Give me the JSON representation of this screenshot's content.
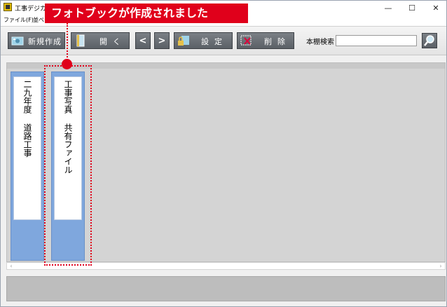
{
  "window": {
    "title": "工事デジカメ",
    "controls": {
      "minimize": "—",
      "maximize": "☐",
      "close": "✕"
    }
  },
  "menu": {
    "items": [
      "ファイル(F)",
      "並べ"
    ]
  },
  "callout": {
    "text": "フォトブックが作成されました"
  },
  "toolbar": {
    "new_label": "新規作成",
    "open_label": "開く",
    "prev_label": "<",
    "next_label": ">",
    "settings_label": "設定",
    "delete_label": "削除",
    "search_label": "本棚検索",
    "search_value": ""
  },
  "shelf": {
    "books": [
      {
        "title": "二九年度 道路工事"
      },
      {
        "title": "工事写真 共有ファイル"
      }
    ]
  },
  "colors": {
    "accent": "#e0001b",
    "book": "#7fa7dd",
    "toolbar_button": "#5b6066"
  },
  "icons": [
    "new-photobook-icon",
    "open-book-icon",
    "lock-settings-icon",
    "delete-x-icon",
    "magnifier-icon"
  ]
}
